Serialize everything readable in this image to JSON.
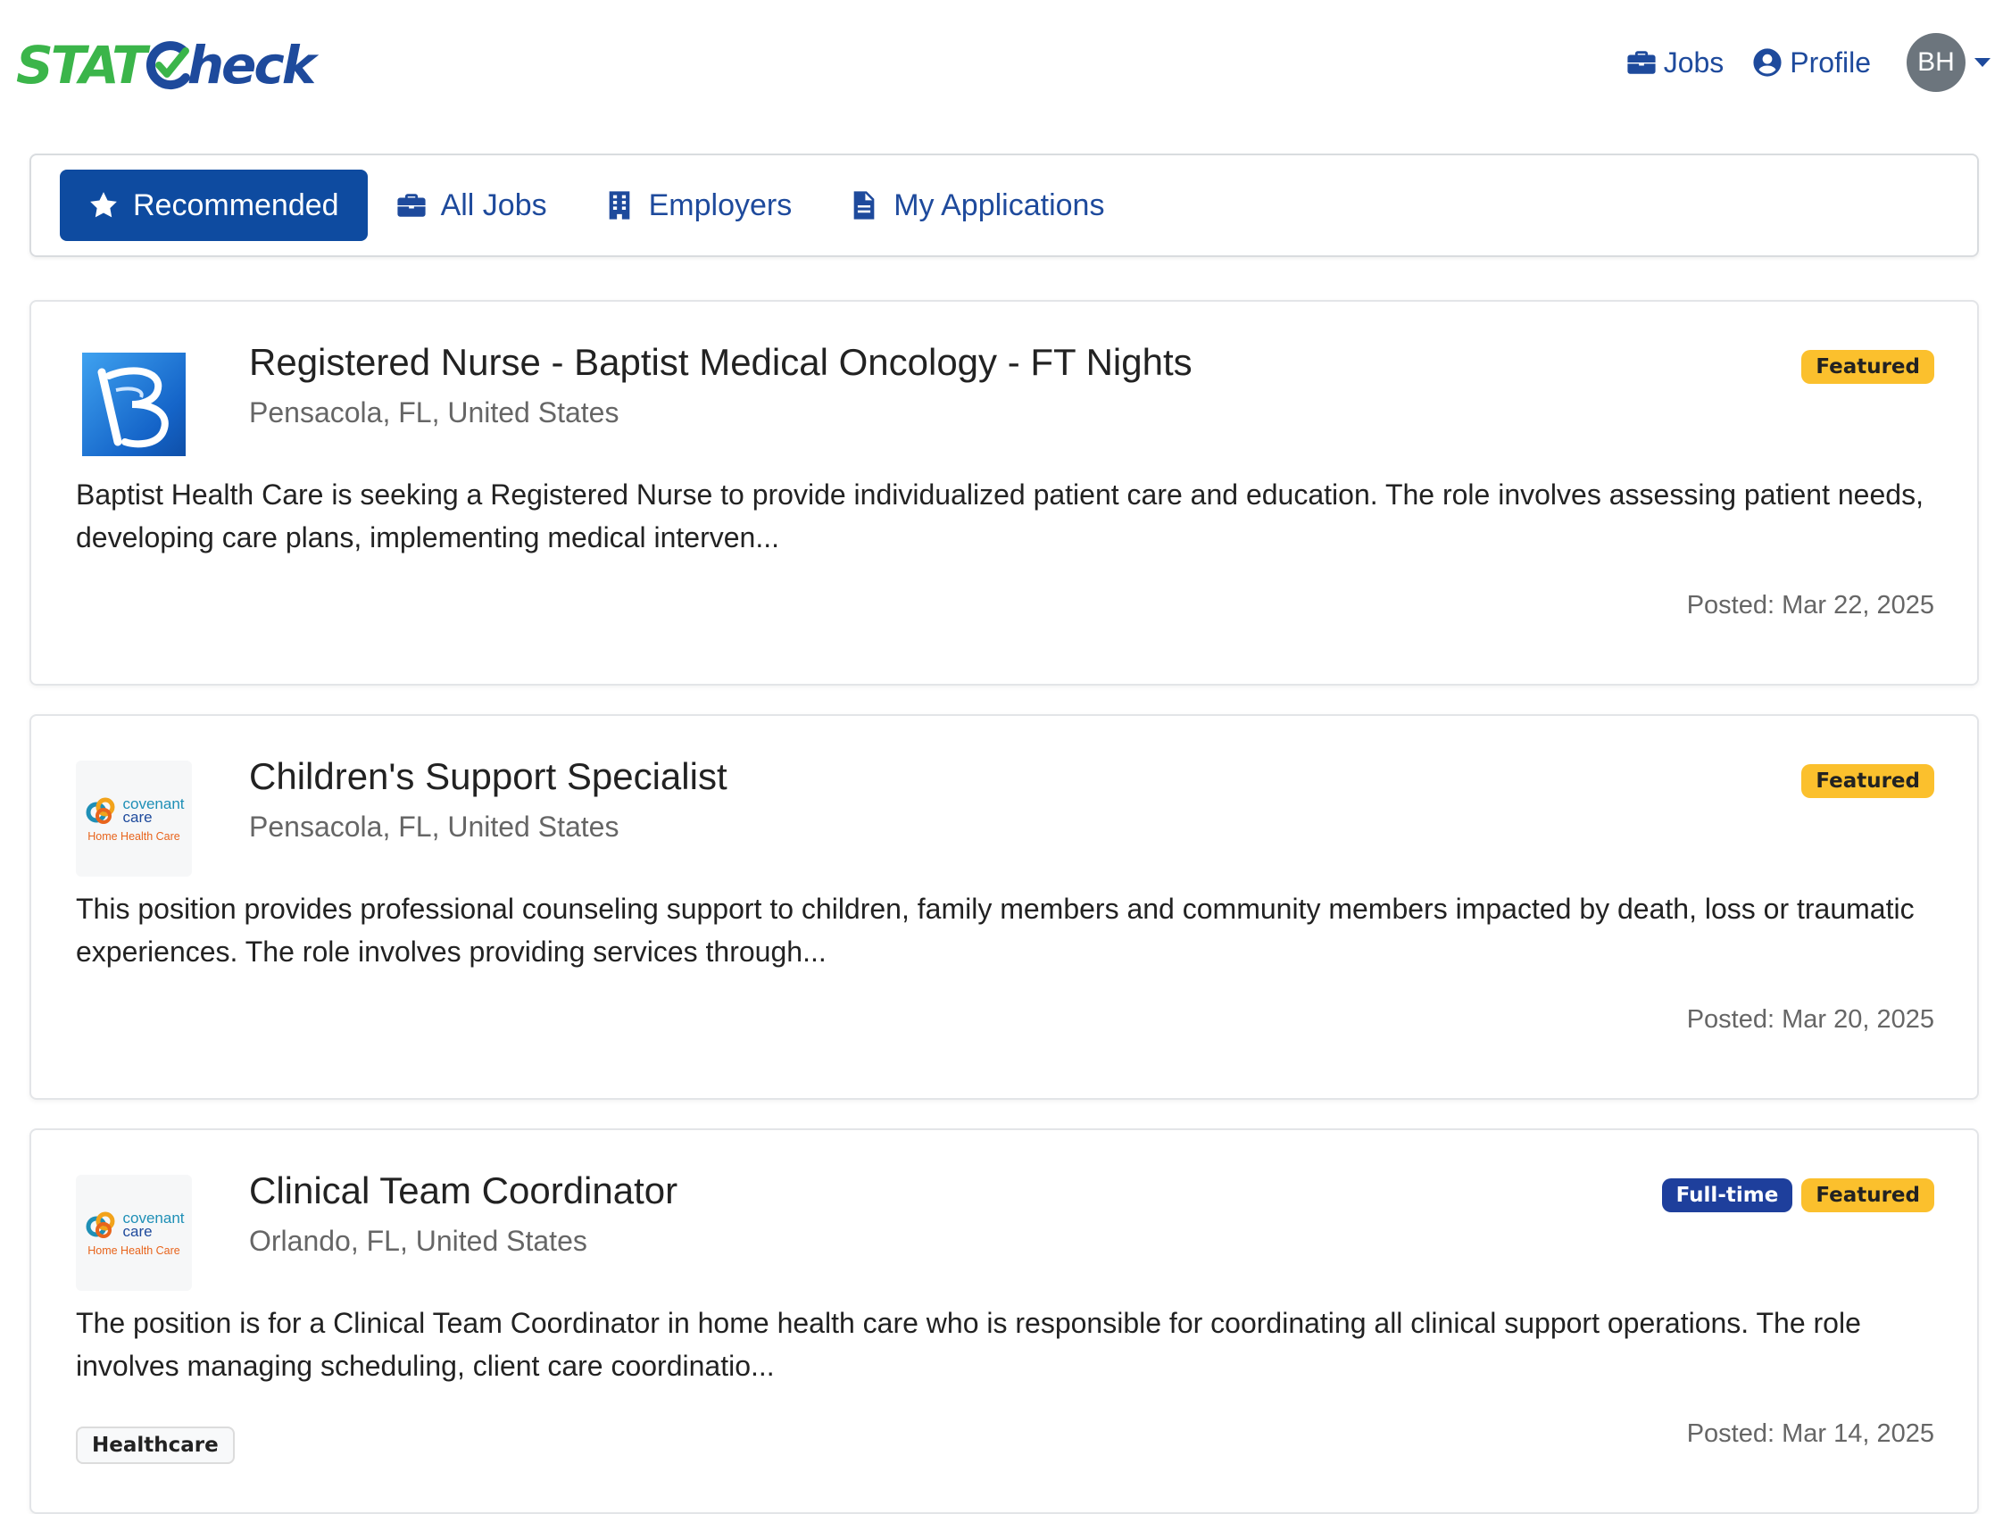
{
  "brand": {
    "part1": "STAT",
    "part2": "heck"
  },
  "topnav": {
    "jobs_label": "Jobs",
    "profile_label": "Profile",
    "avatar_initials": "BH"
  },
  "tabs": [
    {
      "label": "Recommended",
      "icon": "star-icon",
      "active": true
    },
    {
      "label": "All Jobs",
      "icon": "briefcase-icon",
      "active": false
    },
    {
      "label": "Employers",
      "icon": "building-icon",
      "active": false
    },
    {
      "label": "My Applications",
      "icon": "document-icon",
      "active": false
    }
  ],
  "colors": {
    "primary": "#1e4a9c",
    "active_tab": "#0e4ba0",
    "brand_green": "#3bb54a",
    "featured": "#fbc02d",
    "fulltime": "#1e3f9c"
  },
  "jobs": [
    {
      "title": "Registered Nurse - Baptist Medical Oncology - FT Nights",
      "location": "Pensacola, FL, United States",
      "badges": [
        "Featured"
      ],
      "description": "Baptist Health Care is seeking a Registered Nurse to provide individualized patient care and education. The role involves assessing patient needs, developing care plans, implementing medical interven...",
      "posted": "Posted: Mar 22, 2025",
      "employer_logo": "baptist-logo"
    },
    {
      "title": "Children's Support Specialist",
      "location": "Pensacola, FL, United States",
      "badges": [
        "Featured"
      ],
      "description": "This position provides professional counseling support to children, family members and community members impacted by death, loss or traumatic experiences. The role involves providing services through...",
      "posted": "Posted: Mar 20, 2025",
      "employer_logo": "covenant-care-logo",
      "logo_text": {
        "line1": "covenant",
        "line2": "care",
        "line3": "Home Health Care"
      }
    },
    {
      "title": "Clinical Team Coordinator",
      "location": "Orlando, FL, United States",
      "badges": [
        "Full-time",
        "Featured"
      ],
      "description": "The position is for a Clinical Team Coordinator in home health care who is responsible for coordinating all clinical support operations. The role involves managing scheduling, client care coordinatio...",
      "posted": "Posted: Mar 14, 2025",
      "tag": "Healthcare",
      "employer_logo": "covenant-care-logo",
      "logo_text": {
        "line1": "covenant",
        "line2": "care",
        "line3": "Home Health Care"
      }
    }
  ]
}
